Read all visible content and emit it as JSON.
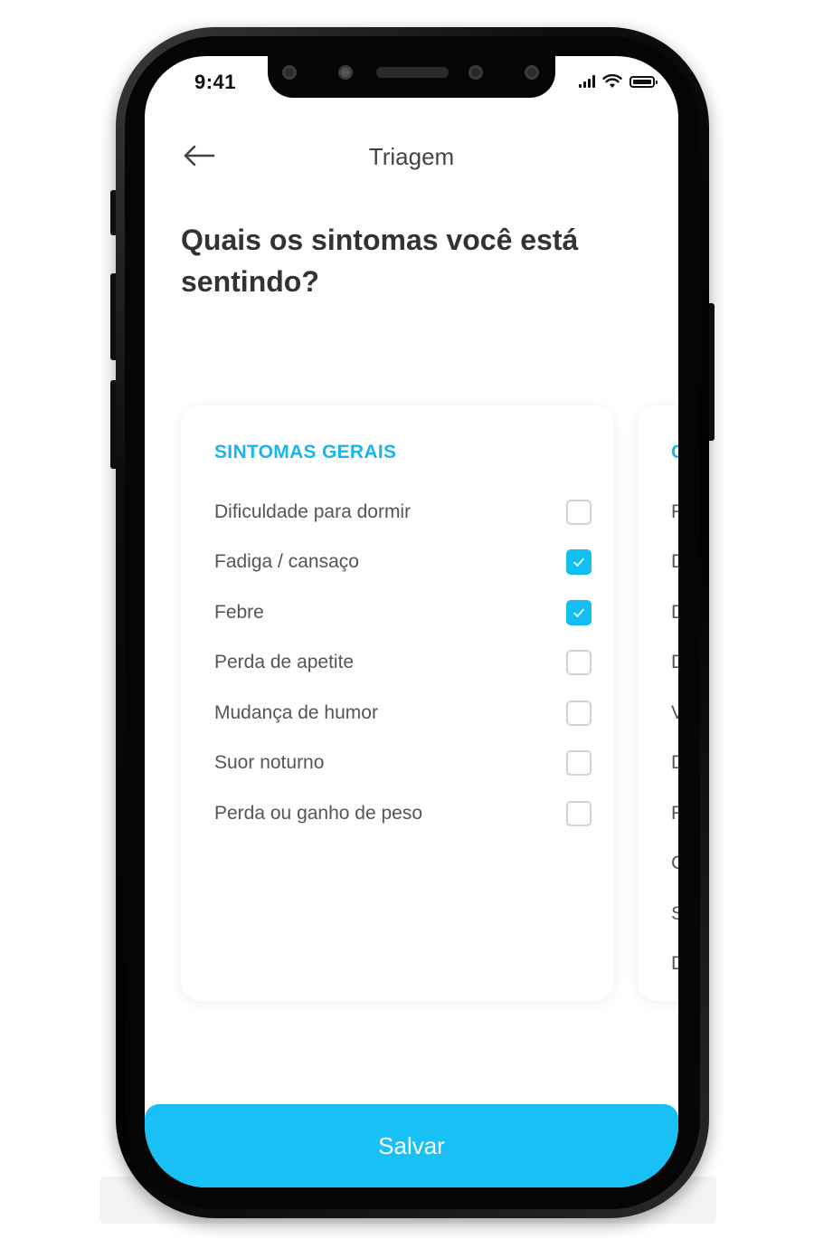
{
  "status_bar": {
    "time": "9:41"
  },
  "header": {
    "title": "Triagem",
    "back_icon": "arrow-left-icon"
  },
  "question": "Quais os sintomas você está sentindo?",
  "colors": {
    "accent": "#11bff2",
    "heading": "#19b5ec",
    "save": "#18c0f5"
  },
  "card": {
    "heading": "SINTOMAS GERAIS",
    "options": [
      {
        "label": "Dificuldade para dormir",
        "checked": false
      },
      {
        "label": "Fadiga / cansaço",
        "checked": true
      },
      {
        "label": "Febre",
        "checked": true
      },
      {
        "label": "Perda de apetite",
        "checked": false
      },
      {
        "label": "Mudança de humor",
        "checked": false
      },
      {
        "label": "Suor noturno",
        "checked": false
      },
      {
        "label": "Perda ou ganho de peso",
        "checked": false
      }
    ]
  },
  "next_card": {
    "heading": "C",
    "items": [
      "F",
      "D",
      "D",
      "D",
      "V",
      "D",
      "F",
      "C",
      "S",
      "D"
    ]
  },
  "footer": {
    "save_label": "Salvar"
  }
}
